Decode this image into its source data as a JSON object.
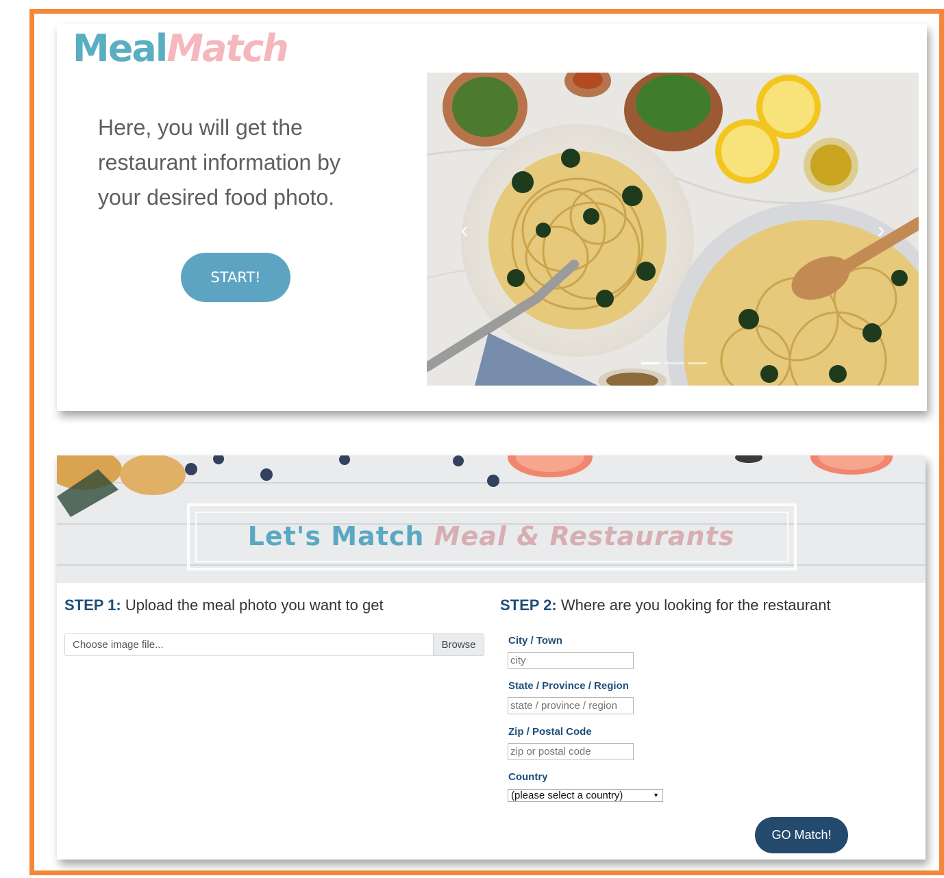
{
  "hero": {
    "logo_part1": "Meal",
    "logo_part2": "Match",
    "tagline": "Here, you will get the restaurant information by your desired food photo.",
    "start_label": "START!"
  },
  "banner": {
    "title_part1": "Let's Match ",
    "title_part2": "Meal & Restaurants"
  },
  "step1": {
    "prefix": "STEP 1:",
    "text": " Upload the meal photo you want to get",
    "file_placeholder": "Choose image file...",
    "browse_label": "Browse"
  },
  "step2": {
    "prefix": "STEP 2:",
    "text": " Where are you looking for the restaurant",
    "city_label": "City / Town",
    "city_placeholder": "city",
    "state_label": "State / Province / Region",
    "state_placeholder": "state / province / region",
    "zip_label": "Zip / Postal Code",
    "zip_placeholder": "zip or postal code",
    "country_label": "Country",
    "country_selected": "(please select a country)",
    "go_label": "GO Match!"
  },
  "colors": {
    "frame": "#f4883a",
    "brand_blue": "#5aaec2",
    "brand_pink": "#f4b7bd",
    "navy": "#1f4e79",
    "button_dark": "#244a6e"
  }
}
